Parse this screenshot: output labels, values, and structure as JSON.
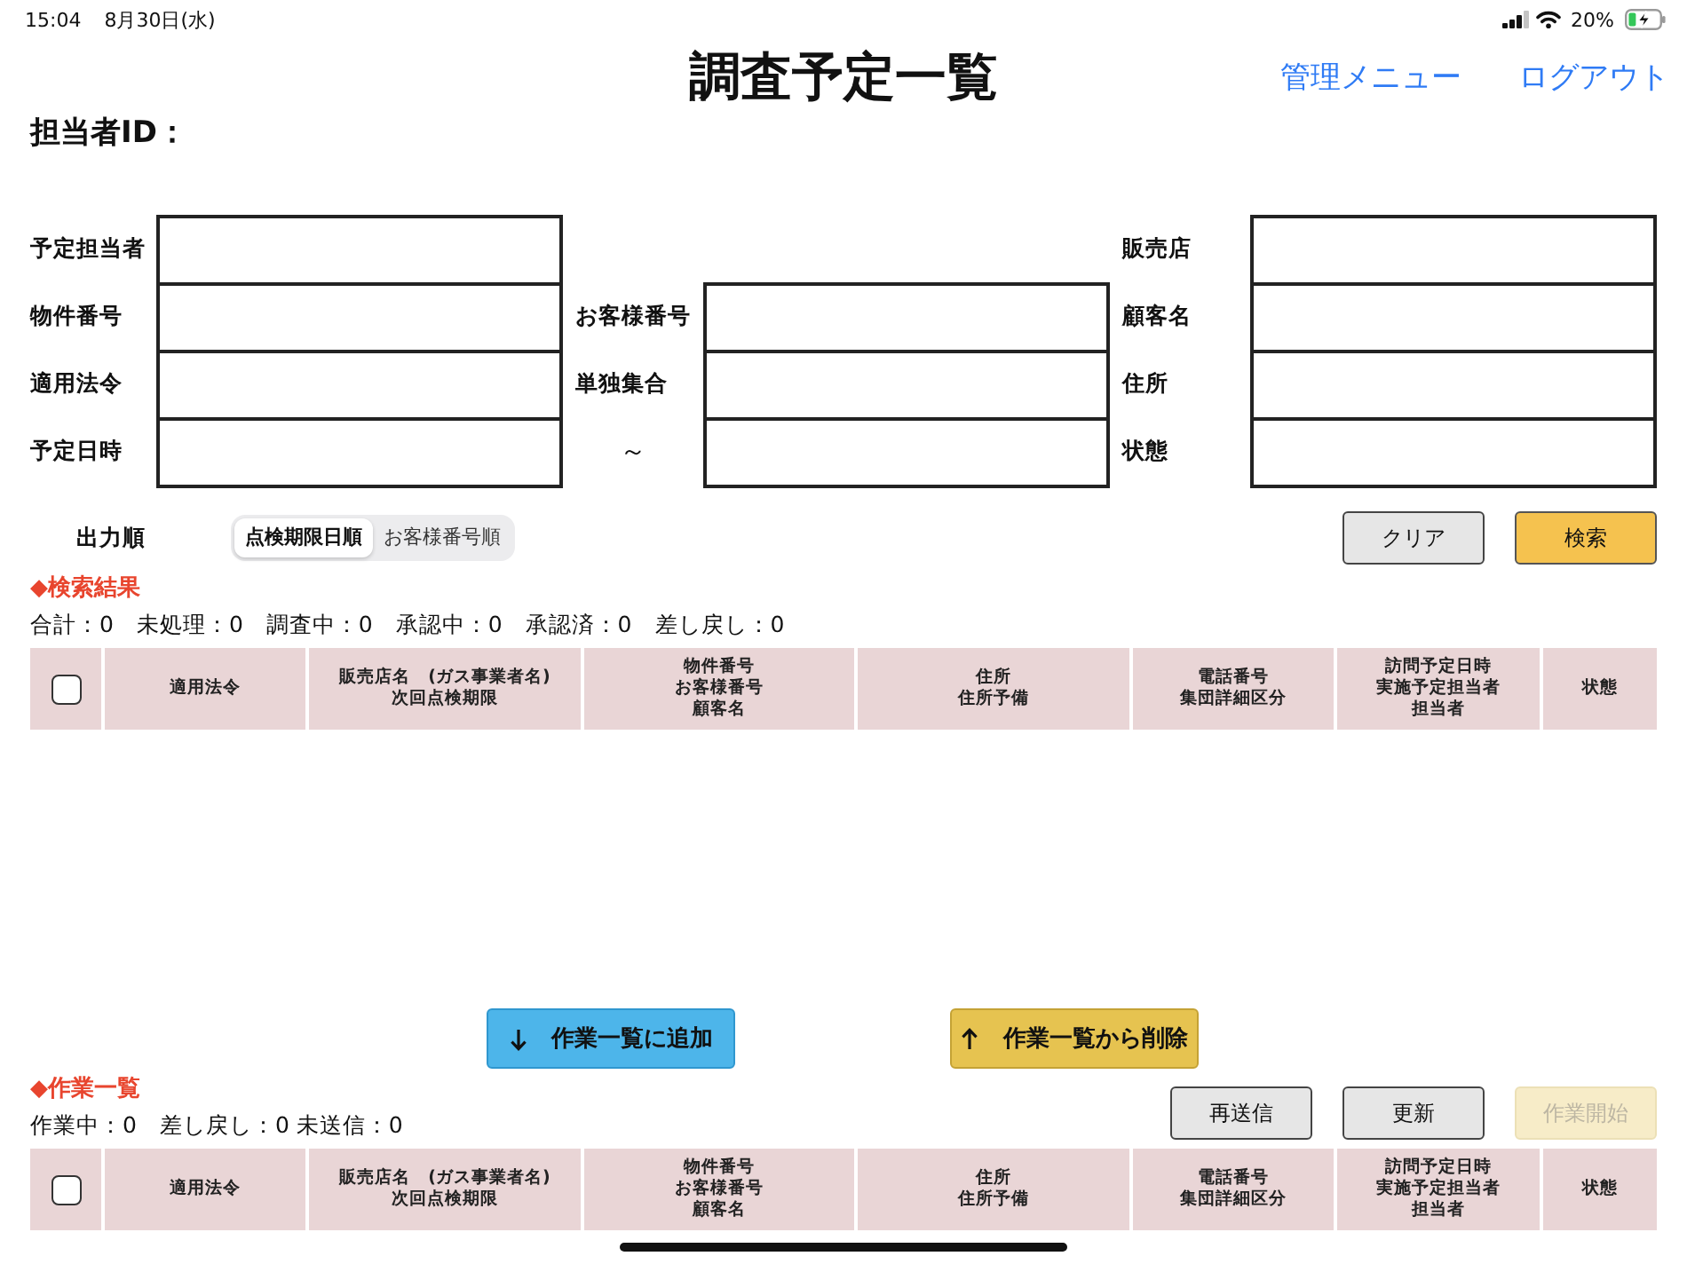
{
  "status_bar": {
    "time": "15:04",
    "date": "8月30日(水)",
    "battery": "20%"
  },
  "header": {
    "title": "調査予定一覧",
    "links": [
      {
        "label": "管理メニュー"
      },
      {
        "label": "ログアウト"
      }
    ]
  },
  "user": {
    "label": "担当者ID："
  },
  "search_form": {
    "rows": [
      {
        "cells": [
          {
            "kind": "input",
            "label": "予定担当者"
          },
          {
            "kind": "blank"
          },
          {
            "kind": "input",
            "label": "販売店"
          }
        ]
      },
      {
        "cells": [
          {
            "kind": "input",
            "label": "物件番号"
          },
          {
            "kind": "input",
            "label": "お客様番号"
          },
          {
            "kind": "input",
            "label": "顧客名"
          }
        ]
      },
      {
        "cells": [
          {
            "kind": "input",
            "label": "適用法令"
          },
          {
            "kind": "input",
            "label": "単独集合"
          },
          {
            "kind": "input",
            "label": "住所"
          }
        ]
      },
      {
        "cells": [
          {
            "kind": "input",
            "label": "予定日時"
          },
          {
            "kind": "range_end",
            "label": "～"
          },
          {
            "kind": "input",
            "label": "状態"
          }
        ]
      }
    ]
  },
  "output_order": {
    "label": "出力順",
    "options": [
      {
        "label": "点検期限日順",
        "selected": true
      },
      {
        "label": "お客様番号順",
        "selected": false
      }
    ],
    "buttons": [
      {
        "label": "クリア",
        "kind": "secondary",
        "disabled": false
      },
      {
        "label": "検索",
        "kind": "primary",
        "disabled": false
      }
    ]
  },
  "search_results": {
    "heading": "◆検索結果",
    "counts": "合計：0　未処理：0　調査中：0　承認中：0　承認済：0　差し戻し：0",
    "table": {
      "columns": [
        {
          "kind": "checkbox",
          "checked": false
        },
        {
          "kind": "text",
          "lines": [
            "適用法令"
          ]
        },
        {
          "kind": "text",
          "lines": [
            "販売店名　(ガス事業者名)",
            "次回点検期限"
          ]
        },
        {
          "kind": "text",
          "lines": [
            "物件番号",
            "お客様番号",
            "顧客名"
          ]
        },
        {
          "kind": "text",
          "lines": [
            "住所",
            "住所予備"
          ]
        },
        {
          "kind": "text",
          "lines": [
            "電話番号",
            "集団詳細区分"
          ]
        },
        {
          "kind": "text",
          "lines": [
            "訪問予定日時",
            "実施予定担当者",
            "担当者"
          ]
        },
        {
          "kind": "text",
          "lines": [
            "状態"
          ]
        }
      ]
    }
  },
  "transfer_buttons": [
    {
      "kind": "add",
      "label": "作業一覧に追加"
    },
    {
      "kind": "remove",
      "label": "作業一覧から削除"
    }
  ],
  "work_list": {
    "heading": "◆作業一覧",
    "counts": "作業中：0　差し戻し：0 未送信：0",
    "buttons": [
      {
        "label": "再送信",
        "kind": "secondary",
        "disabled": false
      },
      {
        "label": "更新",
        "kind": "secondary",
        "disabled": false
      },
      {
        "label": "作業開始",
        "kind": "primary",
        "disabled": true
      }
    ],
    "table": {
      "columns": [
        {
          "kind": "checkbox",
          "checked": false
        },
        {
          "kind": "text",
          "lines": [
            "適用法令"
          ]
        },
        {
          "kind": "text",
          "lines": [
            "販売店名　(ガス事業者名)",
            "次回点検期限"
          ]
        },
        {
          "kind": "text",
          "lines": [
            "物件番号",
            "お客様番号",
            "顧客名"
          ]
        },
        {
          "kind": "text",
          "lines": [
            "住所",
            "住所予備"
          ]
        },
        {
          "kind": "text",
          "lines": [
            "電話番号",
            "集団詳細区分"
          ]
        },
        {
          "kind": "text",
          "lines": [
            "訪問予定日時",
            "実施予定担当者",
            "担当者"
          ]
        },
        {
          "kind": "text",
          "lines": [
            "状態"
          ]
        }
      ]
    }
  }
}
